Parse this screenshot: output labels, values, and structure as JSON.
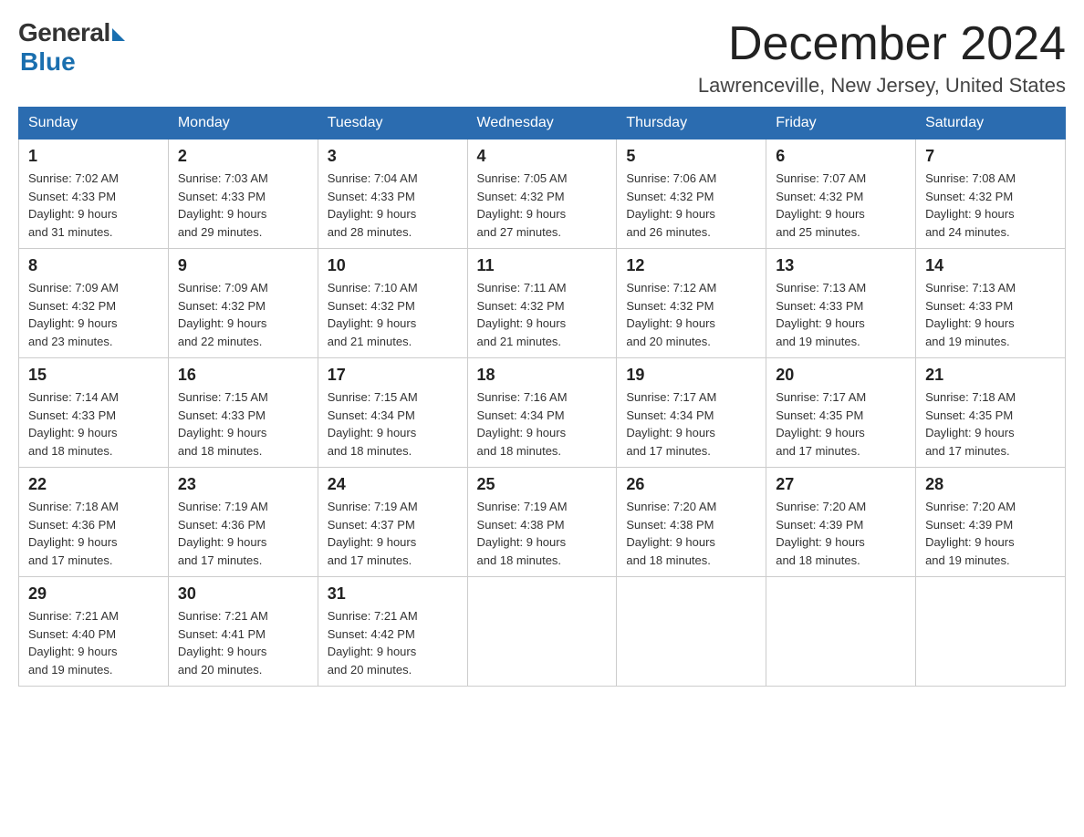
{
  "logo": {
    "text_general": "General",
    "text_blue": "Blue"
  },
  "title": {
    "month": "December 2024",
    "location": "Lawrenceville, New Jersey, United States"
  },
  "headers": [
    "Sunday",
    "Monday",
    "Tuesday",
    "Wednesday",
    "Thursday",
    "Friday",
    "Saturday"
  ],
  "weeks": [
    [
      {
        "day": "1",
        "sunrise": "7:02 AM",
        "sunset": "4:33 PM",
        "daylight": "9 hours and 31 minutes."
      },
      {
        "day": "2",
        "sunrise": "7:03 AM",
        "sunset": "4:33 PM",
        "daylight": "9 hours and 29 minutes."
      },
      {
        "day": "3",
        "sunrise": "7:04 AM",
        "sunset": "4:33 PM",
        "daylight": "9 hours and 28 minutes."
      },
      {
        "day": "4",
        "sunrise": "7:05 AM",
        "sunset": "4:32 PM",
        "daylight": "9 hours and 27 minutes."
      },
      {
        "day": "5",
        "sunrise": "7:06 AM",
        "sunset": "4:32 PM",
        "daylight": "9 hours and 26 minutes."
      },
      {
        "day": "6",
        "sunrise": "7:07 AM",
        "sunset": "4:32 PM",
        "daylight": "9 hours and 25 minutes."
      },
      {
        "day": "7",
        "sunrise": "7:08 AM",
        "sunset": "4:32 PM",
        "daylight": "9 hours and 24 minutes."
      }
    ],
    [
      {
        "day": "8",
        "sunrise": "7:09 AM",
        "sunset": "4:32 PM",
        "daylight": "9 hours and 23 minutes."
      },
      {
        "day": "9",
        "sunrise": "7:09 AM",
        "sunset": "4:32 PM",
        "daylight": "9 hours and 22 minutes."
      },
      {
        "day": "10",
        "sunrise": "7:10 AM",
        "sunset": "4:32 PM",
        "daylight": "9 hours and 21 minutes."
      },
      {
        "day": "11",
        "sunrise": "7:11 AM",
        "sunset": "4:32 PM",
        "daylight": "9 hours and 21 minutes."
      },
      {
        "day": "12",
        "sunrise": "7:12 AM",
        "sunset": "4:32 PM",
        "daylight": "9 hours and 20 minutes."
      },
      {
        "day": "13",
        "sunrise": "7:13 AM",
        "sunset": "4:33 PM",
        "daylight": "9 hours and 19 minutes."
      },
      {
        "day": "14",
        "sunrise": "7:13 AM",
        "sunset": "4:33 PM",
        "daylight": "9 hours and 19 minutes."
      }
    ],
    [
      {
        "day": "15",
        "sunrise": "7:14 AM",
        "sunset": "4:33 PM",
        "daylight": "9 hours and 18 minutes."
      },
      {
        "day": "16",
        "sunrise": "7:15 AM",
        "sunset": "4:33 PM",
        "daylight": "9 hours and 18 minutes."
      },
      {
        "day": "17",
        "sunrise": "7:15 AM",
        "sunset": "4:34 PM",
        "daylight": "9 hours and 18 minutes."
      },
      {
        "day": "18",
        "sunrise": "7:16 AM",
        "sunset": "4:34 PM",
        "daylight": "9 hours and 18 minutes."
      },
      {
        "day": "19",
        "sunrise": "7:17 AM",
        "sunset": "4:34 PM",
        "daylight": "9 hours and 17 minutes."
      },
      {
        "day": "20",
        "sunrise": "7:17 AM",
        "sunset": "4:35 PM",
        "daylight": "9 hours and 17 minutes."
      },
      {
        "day": "21",
        "sunrise": "7:18 AM",
        "sunset": "4:35 PM",
        "daylight": "9 hours and 17 minutes."
      }
    ],
    [
      {
        "day": "22",
        "sunrise": "7:18 AM",
        "sunset": "4:36 PM",
        "daylight": "9 hours and 17 minutes."
      },
      {
        "day": "23",
        "sunrise": "7:19 AM",
        "sunset": "4:36 PM",
        "daylight": "9 hours and 17 minutes."
      },
      {
        "day": "24",
        "sunrise": "7:19 AM",
        "sunset": "4:37 PM",
        "daylight": "9 hours and 17 minutes."
      },
      {
        "day": "25",
        "sunrise": "7:19 AM",
        "sunset": "4:38 PM",
        "daylight": "9 hours and 18 minutes."
      },
      {
        "day": "26",
        "sunrise": "7:20 AM",
        "sunset": "4:38 PM",
        "daylight": "9 hours and 18 minutes."
      },
      {
        "day": "27",
        "sunrise": "7:20 AM",
        "sunset": "4:39 PM",
        "daylight": "9 hours and 18 minutes."
      },
      {
        "day": "28",
        "sunrise": "7:20 AM",
        "sunset": "4:39 PM",
        "daylight": "9 hours and 19 minutes."
      }
    ],
    [
      {
        "day": "29",
        "sunrise": "7:21 AM",
        "sunset": "4:40 PM",
        "daylight": "9 hours and 19 minutes."
      },
      {
        "day": "30",
        "sunrise": "7:21 AM",
        "sunset": "4:41 PM",
        "daylight": "9 hours and 20 minutes."
      },
      {
        "day": "31",
        "sunrise": "7:21 AM",
        "sunset": "4:42 PM",
        "daylight": "9 hours and 20 minutes."
      },
      null,
      null,
      null,
      null
    ]
  ]
}
